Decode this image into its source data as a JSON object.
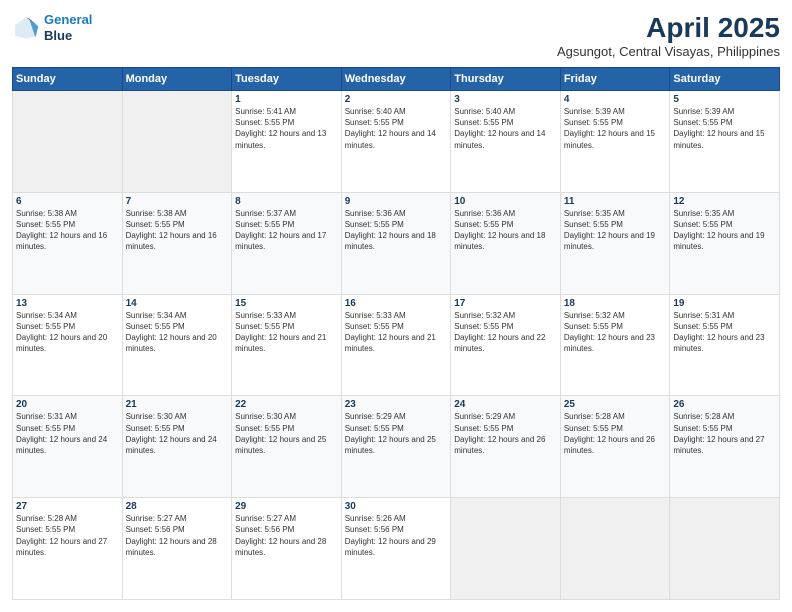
{
  "logo": {
    "line1": "General",
    "line2": "Blue"
  },
  "title": "April 2025",
  "subtitle": "Agsungot, Central Visayas, Philippines",
  "weekdays": [
    "Sunday",
    "Monday",
    "Tuesday",
    "Wednesday",
    "Thursday",
    "Friday",
    "Saturday"
  ],
  "weeks": [
    [
      {
        "day": "",
        "sunrise": "",
        "sunset": "",
        "daylight": ""
      },
      {
        "day": "",
        "sunrise": "",
        "sunset": "",
        "daylight": ""
      },
      {
        "day": "1",
        "sunrise": "Sunrise: 5:41 AM",
        "sunset": "Sunset: 5:55 PM",
        "daylight": "Daylight: 12 hours and 13 minutes."
      },
      {
        "day": "2",
        "sunrise": "Sunrise: 5:40 AM",
        "sunset": "Sunset: 5:55 PM",
        "daylight": "Daylight: 12 hours and 14 minutes."
      },
      {
        "day": "3",
        "sunrise": "Sunrise: 5:40 AM",
        "sunset": "Sunset: 5:55 PM",
        "daylight": "Daylight: 12 hours and 14 minutes."
      },
      {
        "day": "4",
        "sunrise": "Sunrise: 5:39 AM",
        "sunset": "Sunset: 5:55 PM",
        "daylight": "Daylight: 12 hours and 15 minutes."
      },
      {
        "day": "5",
        "sunrise": "Sunrise: 5:39 AM",
        "sunset": "Sunset: 5:55 PM",
        "daylight": "Daylight: 12 hours and 15 minutes."
      }
    ],
    [
      {
        "day": "6",
        "sunrise": "Sunrise: 5:38 AM",
        "sunset": "Sunset: 5:55 PM",
        "daylight": "Daylight: 12 hours and 16 minutes."
      },
      {
        "day": "7",
        "sunrise": "Sunrise: 5:38 AM",
        "sunset": "Sunset: 5:55 PM",
        "daylight": "Daylight: 12 hours and 16 minutes."
      },
      {
        "day": "8",
        "sunrise": "Sunrise: 5:37 AM",
        "sunset": "Sunset: 5:55 PM",
        "daylight": "Daylight: 12 hours and 17 minutes."
      },
      {
        "day": "9",
        "sunrise": "Sunrise: 5:36 AM",
        "sunset": "Sunset: 5:55 PM",
        "daylight": "Daylight: 12 hours and 18 minutes."
      },
      {
        "day": "10",
        "sunrise": "Sunrise: 5:36 AM",
        "sunset": "Sunset: 5:55 PM",
        "daylight": "Daylight: 12 hours and 18 minutes."
      },
      {
        "day": "11",
        "sunrise": "Sunrise: 5:35 AM",
        "sunset": "Sunset: 5:55 PM",
        "daylight": "Daylight: 12 hours and 19 minutes."
      },
      {
        "day": "12",
        "sunrise": "Sunrise: 5:35 AM",
        "sunset": "Sunset: 5:55 PM",
        "daylight": "Daylight: 12 hours and 19 minutes."
      }
    ],
    [
      {
        "day": "13",
        "sunrise": "Sunrise: 5:34 AM",
        "sunset": "Sunset: 5:55 PM",
        "daylight": "Daylight: 12 hours and 20 minutes."
      },
      {
        "day": "14",
        "sunrise": "Sunrise: 5:34 AM",
        "sunset": "Sunset: 5:55 PM",
        "daylight": "Daylight: 12 hours and 20 minutes."
      },
      {
        "day": "15",
        "sunrise": "Sunrise: 5:33 AM",
        "sunset": "Sunset: 5:55 PM",
        "daylight": "Daylight: 12 hours and 21 minutes."
      },
      {
        "day": "16",
        "sunrise": "Sunrise: 5:33 AM",
        "sunset": "Sunset: 5:55 PM",
        "daylight": "Daylight: 12 hours and 21 minutes."
      },
      {
        "day": "17",
        "sunrise": "Sunrise: 5:32 AM",
        "sunset": "Sunset: 5:55 PM",
        "daylight": "Daylight: 12 hours and 22 minutes."
      },
      {
        "day": "18",
        "sunrise": "Sunrise: 5:32 AM",
        "sunset": "Sunset: 5:55 PM",
        "daylight": "Daylight: 12 hours and 23 minutes."
      },
      {
        "day": "19",
        "sunrise": "Sunrise: 5:31 AM",
        "sunset": "Sunset: 5:55 PM",
        "daylight": "Daylight: 12 hours and 23 minutes."
      }
    ],
    [
      {
        "day": "20",
        "sunrise": "Sunrise: 5:31 AM",
        "sunset": "Sunset: 5:55 PM",
        "daylight": "Daylight: 12 hours and 24 minutes."
      },
      {
        "day": "21",
        "sunrise": "Sunrise: 5:30 AM",
        "sunset": "Sunset: 5:55 PM",
        "daylight": "Daylight: 12 hours and 24 minutes."
      },
      {
        "day": "22",
        "sunrise": "Sunrise: 5:30 AM",
        "sunset": "Sunset: 5:55 PM",
        "daylight": "Daylight: 12 hours and 25 minutes."
      },
      {
        "day": "23",
        "sunrise": "Sunrise: 5:29 AM",
        "sunset": "Sunset: 5:55 PM",
        "daylight": "Daylight: 12 hours and 25 minutes."
      },
      {
        "day": "24",
        "sunrise": "Sunrise: 5:29 AM",
        "sunset": "Sunset: 5:55 PM",
        "daylight": "Daylight: 12 hours and 26 minutes."
      },
      {
        "day": "25",
        "sunrise": "Sunrise: 5:28 AM",
        "sunset": "Sunset: 5:55 PM",
        "daylight": "Daylight: 12 hours and 26 minutes."
      },
      {
        "day": "26",
        "sunrise": "Sunrise: 5:28 AM",
        "sunset": "Sunset: 5:55 PM",
        "daylight": "Daylight: 12 hours and 27 minutes."
      }
    ],
    [
      {
        "day": "27",
        "sunrise": "Sunrise: 5:28 AM",
        "sunset": "Sunset: 5:55 PM",
        "daylight": "Daylight: 12 hours and 27 minutes."
      },
      {
        "day": "28",
        "sunrise": "Sunrise: 5:27 AM",
        "sunset": "Sunset: 5:56 PM",
        "daylight": "Daylight: 12 hours and 28 minutes."
      },
      {
        "day": "29",
        "sunrise": "Sunrise: 5:27 AM",
        "sunset": "Sunset: 5:56 PM",
        "daylight": "Daylight: 12 hours and 28 minutes."
      },
      {
        "day": "30",
        "sunrise": "Sunrise: 5:26 AM",
        "sunset": "Sunset: 5:56 PM",
        "daylight": "Daylight: 12 hours and 29 minutes."
      },
      {
        "day": "",
        "sunrise": "",
        "sunset": "",
        "daylight": ""
      },
      {
        "day": "",
        "sunrise": "",
        "sunset": "",
        "daylight": ""
      },
      {
        "day": "",
        "sunrise": "",
        "sunset": "",
        "daylight": ""
      }
    ]
  ]
}
